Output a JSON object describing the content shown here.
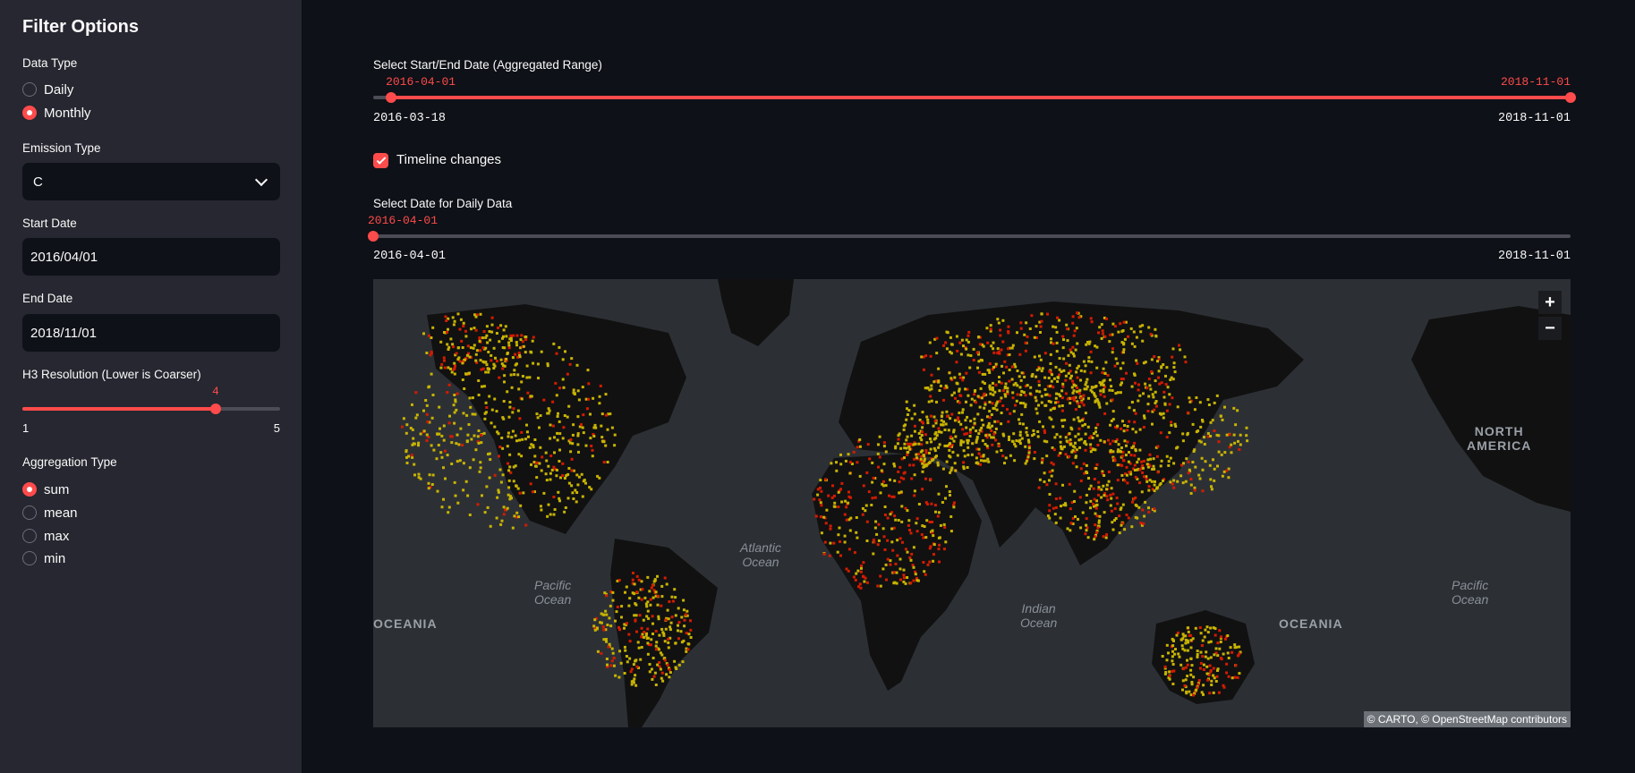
{
  "sidebar": {
    "title": "Filter Options",
    "data_type": {
      "label": "Data Type",
      "options": [
        "Daily",
        "Monthly"
      ],
      "selected": "Monthly"
    },
    "emission_type": {
      "label": "Emission Type",
      "value": "C"
    },
    "start_date": {
      "label": "Start Date",
      "value": "2016/04/01"
    },
    "end_date": {
      "label": "End Date",
      "value": "2018/11/01"
    },
    "h3_resolution": {
      "label": "H3 Resolution (Lower is Coarser)",
      "value": "4",
      "min": "1",
      "max": "5",
      "fraction": 0.75
    },
    "aggregation": {
      "label": "Aggregation Type",
      "options": [
        "sum",
        "mean",
        "max",
        "min"
      ],
      "selected": "sum"
    }
  },
  "range_slider": {
    "label": "Select Start/End Date (Aggregated Range)",
    "start_value": "2016-04-01",
    "end_value": "2018-11-01",
    "min": "2016-03-18",
    "max": "2018-11-01",
    "start_fraction": 0.015,
    "end_fraction": 1.0
  },
  "timeline_checkbox": {
    "label": "Timeline changes",
    "checked": true
  },
  "daily_slider": {
    "label": "Select Date for Daily Data",
    "value": "2016-04-01",
    "min": "2016-04-01",
    "max": "2018-11-01",
    "fraction": 0.0
  },
  "map": {
    "labels": {
      "north_america": "NORTH\nAMERICA",
      "atlantic": "Atlantic\nOcean",
      "pacific_left": "Pacific\nOcean",
      "pacific_right": "Pacific\nOcean",
      "indian": "Indian\nOcean",
      "oceania_left": "OCEANIA",
      "oceania_right": "OCEANIA"
    },
    "zoom_in": "+",
    "zoom_out": "−",
    "attribution": "© CARTO, © OpenStreetMap contributors",
    "colors": {
      "water": "#2c3035",
      "land": "#111111",
      "low": "#c8b400",
      "high": "#d41b00"
    }
  }
}
